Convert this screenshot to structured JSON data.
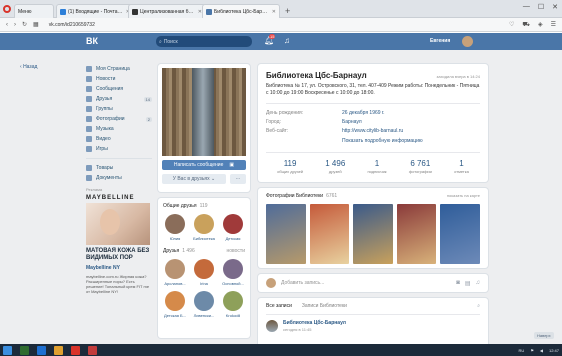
{
  "browser": {
    "tabs": [
      {
        "label": "Меню",
        "color": "#d9332a"
      },
      {
        "label": "(1) Входящие - Почта Mail.Ru",
        "color": "#2d7fd8"
      },
      {
        "label": "Централизованная библ...",
        "color": "#333333"
      },
      {
        "label": "Библиотека Цбс-Барнаул",
        "color": "#4a76a8"
      }
    ],
    "new_tab": "+",
    "address": "vk.com/id210659732"
  },
  "vk": {
    "logo": "ВК",
    "search_placeholder": "Поиск",
    "notif_count": "15",
    "user_name": "Евгения"
  },
  "left_nav": {
    "back": "Назад",
    "items": [
      {
        "label": "Моя Страница"
      },
      {
        "label": "Новости"
      },
      {
        "label": "Сообщения"
      },
      {
        "label": "Друзья",
        "count": "14"
      },
      {
        "label": "Группы"
      },
      {
        "label": "Фотографии",
        "count": "2"
      },
      {
        "label": "Музыка"
      },
      {
        "label": "Видео"
      },
      {
        "label": "Игры"
      }
    ],
    "items2": [
      {
        "label": "Товары"
      },
      {
        "label": "Документы"
      }
    ],
    "ads_label": "Реклама",
    "ad_brand": "MAYBELLINE",
    "ad_headline": "МАТОВАЯ КОЖА БЕЗ ВИДИМЫХ ПОР",
    "ad_title": "Maybelline NY",
    "ad_text": "maybelline.com.ru Жирная кожа? Расширенные поры? Есть решение! Тональный крем FIT me от Maybelline NY!"
  },
  "profile": {
    "write_message": "Написать сообщение",
    "in_friends": "У Вас в друзьях",
    "more": "···"
  },
  "friends": {
    "common_title": "Общие друзья",
    "common_count": "119",
    "common": [
      {
        "name": "Юлия",
        "color": "#8a6d5a"
      },
      {
        "name": "Библиотека",
        "color": "#c9a15c"
      },
      {
        "name": "Детская",
        "color": "#a03a3a"
      }
    ],
    "title": "Друзья",
    "count": "1 496",
    "news_link": "новости",
    "list": [
      {
        "name": "Арсланов...",
        "color": "#b89373"
      },
      {
        "name": "Irina",
        "color": "#c46a3b"
      },
      {
        "name": "Основной...",
        "color": "#7a6a8a"
      },
      {
        "name": "Детская Б...",
        "color": "#d58a4a"
      },
      {
        "name": "Ливенски...",
        "color": "#6d8aa8"
      },
      {
        "name": "Krokodil",
        "color": "#8ea05a"
      }
    ]
  },
  "info": {
    "title": "Библиотека Цбс-Барнаул",
    "last_seen": "заходила вчера в 14:24",
    "status": "Библиотека № 17, ул. Островского, 31, тел. 407-409 Режим работы: Понедельник - Пятница с 10:00 до 19:00 Воскресенье с 10:00 до 18:00.",
    "rows": [
      {
        "k": "День рождения:",
        "v": "26 декабря 1969 г."
      },
      {
        "k": "Город:",
        "v": "Барнаул"
      },
      {
        "k": "Веб-сайт:",
        "v": "http://www.citylib-barnaul.ru"
      }
    ],
    "more_link": "Показать подробную информацию",
    "stats": [
      {
        "n": "119",
        "l": "общих друзей"
      },
      {
        "n": "1 496",
        "l": "друзей"
      },
      {
        "n": "1",
        "l": "подписчик"
      },
      {
        "n": "6 761",
        "l": "фотографии"
      },
      {
        "n": "1",
        "l": "отметка"
      }
    ]
  },
  "photos": {
    "title": "Фотографии Библиотеки",
    "count": "6761",
    "map_link": "показать на карте",
    "items": [
      {
        "color": "#4f6c9a"
      },
      {
        "color": "#c55a3a"
      },
      {
        "color": "#3a5a8a"
      },
      {
        "color": "#8a3a3a"
      },
      {
        "color": "#2f5d9a"
      }
    ]
  },
  "composer": {
    "placeholder": "Добавить запись..."
  },
  "wall": {
    "tab_all": "Все записи",
    "tab_own": "Записи Библиотеки",
    "post_author": "Библиотека Цбс-Барнаул",
    "post_time": "сегодня в 11:45"
  },
  "scroll_top": "Наверх",
  "taskbar": {
    "lang": "RU",
    "time": "12:47"
  }
}
